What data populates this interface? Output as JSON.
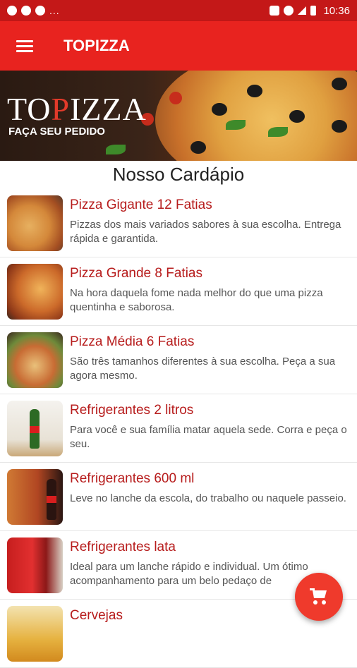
{
  "status_bar": {
    "time": "10:36",
    "overflow_indicator": "..."
  },
  "app_bar": {
    "title": "TOPIZZA",
    "menu_icon": "hamburger-menu-icon"
  },
  "banner": {
    "brand_prefix": "TO",
    "brand_highlight": "P",
    "brand_suffix": "IZZA",
    "tagline": "FAÇA SEU PEDIDO"
  },
  "section_title": "Nosso Cardápio",
  "menu_items": [
    {
      "title": "Pizza Gigante 12 Fatias",
      "description": "Pizzas dos mais variados sabores à sua escolha. Entrega rápida e garantida."
    },
    {
      "title": "Pizza Grande 8 Fatias",
      "description": "Na hora daquela fome nada melhor do que uma pizza quentinha e saborosa."
    },
    {
      "title": "Pizza Média 6 Fatias",
      "description": "São três tamanhos diferentes à sua escolha. Peça a sua agora mesmo."
    },
    {
      "title": "Refrigerantes 2 litros",
      "description": "Para você e sua família matar aquela sede. Corra e peça o seu."
    },
    {
      "title": "Refrigerantes 600 ml",
      "description": "Leve no lanche da escola, do trabalho ou naquele passeio."
    },
    {
      "title": "Refrigerantes lata",
      "description": "Ideal para um lanche rápido e individual. Um ótimo acompanhamento para um belo pedaço de"
    },
    {
      "title": "Cervejas",
      "description": ""
    }
  ],
  "fab": {
    "icon": "shopping-cart-icon"
  },
  "colors": {
    "status_bar": "#c41818",
    "app_bar": "#e8231f",
    "item_title": "#b71c1c",
    "fab": "#ef3a2c"
  }
}
